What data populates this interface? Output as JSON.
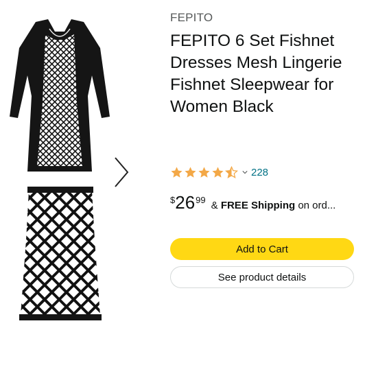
{
  "product": {
    "brand": "FEPITO",
    "title": "FEPITO 6 Set Fishnet Dresses Mesh Lingerie Fishnet Sleepwear for Women Black",
    "rating": 4.5,
    "rating_max": 5,
    "review_count": "228",
    "price": {
      "symbol": "$",
      "whole": "26",
      "fraction": "99"
    },
    "shipping": {
      "prefix": "&",
      "bold": "FREE Shipping",
      "suffix": "on ord..."
    }
  },
  "buttons": {
    "add_to_cart": "Add to Cart",
    "see_details": "See product details"
  },
  "icons": {
    "next": "chevron-right-icon",
    "caret": "chevron-down-icon",
    "star": "star-icon"
  },
  "colors": {
    "star": "#f3a847",
    "link": "#007185",
    "cart_button": "#ffd814",
    "text": "#0f1111",
    "muted": "#565959"
  }
}
